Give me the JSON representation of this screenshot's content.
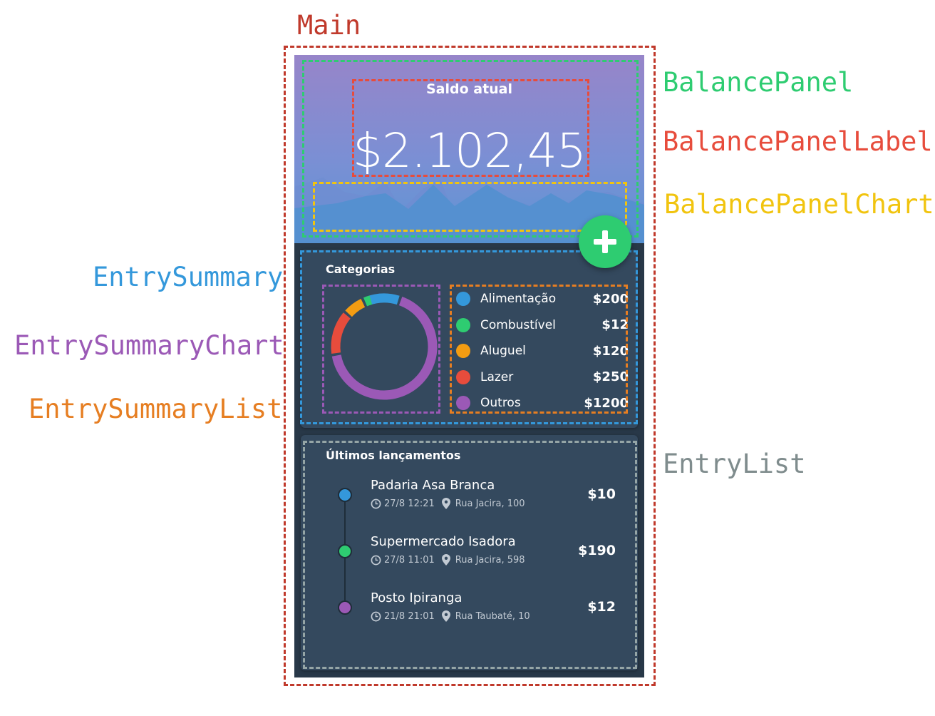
{
  "annotations": {
    "main": "Main",
    "balance_panel": "BalancePanel",
    "balance_panel_label": "BalancePanelLabel",
    "balance_panel_chart": "BalancePanelChart",
    "entry_summary": "EntrySummary",
    "entry_summary_chart": "EntrySummaryChart",
    "entry_summary_list": "EntrySummaryList",
    "entry_list": "EntryList"
  },
  "colors": {
    "main": "#c0392b",
    "balance_panel": "#2ecc71",
    "balance_panel_label": "#e74c3c",
    "balance_panel_chart": "#f1c40f",
    "entry_summary": "#3498db",
    "entry_summary_chart": "#9b59b6",
    "entry_summary_list": "#e67e22",
    "entry_list": "#7f8c8d"
  },
  "balance": {
    "label": "Saldo atual",
    "value": "$2.102,45"
  },
  "add_button": {
    "icon": "plus-icon"
  },
  "summary": {
    "title": "Categorias",
    "categories": [
      {
        "name": "Alimentação",
        "value": "$200",
        "amount": 200,
        "color": "#3498db"
      },
      {
        "name": "Combustível",
        "value": "$12",
        "amount": 12,
        "color": "#2ecc71"
      },
      {
        "name": "Aluguel",
        "value": "$120",
        "amount": 120,
        "color": "#f39c12"
      },
      {
        "name": "Lazer",
        "value": "$250",
        "amount": 250,
        "color": "#e74c3c"
      },
      {
        "name": "Outros",
        "value": "$1200",
        "amount": 1200,
        "color": "#9b59b6"
      }
    ]
  },
  "entries": {
    "title": "Últimos lançamentos",
    "items": [
      {
        "name": "Padaria Asa Branca",
        "date": "27/8 12:21",
        "address": "Rua Jacira, 100",
        "value": "$10",
        "color": "#3498db"
      },
      {
        "name": "Supermercado Isadora",
        "date": "27/8 11:01",
        "address": "Rua Jacira, 598",
        "value": "$190",
        "color": "#2ecc71"
      },
      {
        "name": "Posto Ipiranga",
        "date": "21/8 21:01",
        "address": "Rua Taubaté, 10",
        "value": "$12",
        "color": "#9b59b6"
      }
    ]
  }
}
